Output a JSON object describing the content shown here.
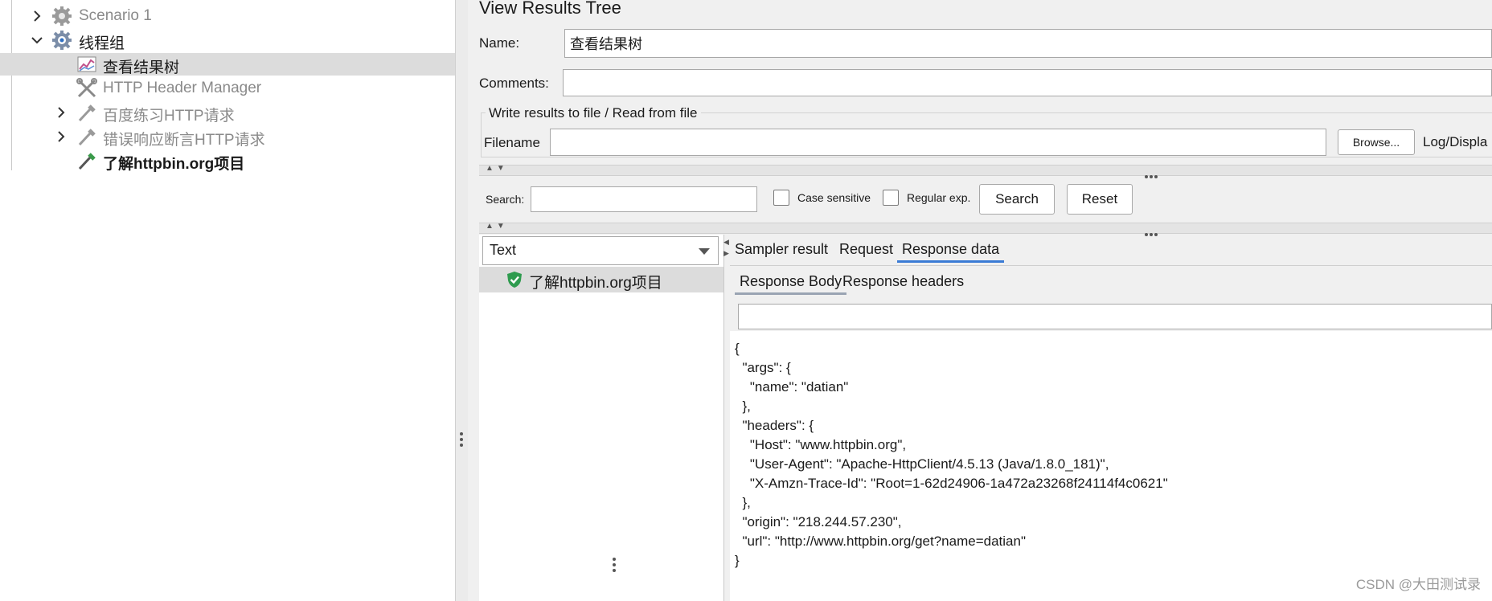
{
  "tree": {
    "items": [
      {
        "label": "Scenario 1",
        "icon": "gear-icon",
        "expand": "collapsed",
        "muted": true
      },
      {
        "label": "线程组",
        "icon": "gear-icon",
        "expand": "expanded",
        "muted": false
      },
      {
        "label": "查看结果树",
        "icon": "chart-icon",
        "expand": "none",
        "muted": false,
        "selected": true
      },
      {
        "label": "HTTP Header Manager",
        "icon": "tools-icon",
        "expand": "none",
        "muted": true
      },
      {
        "label": "百度练习HTTP请求",
        "icon": "pipette-icon",
        "expand": "collapsed",
        "muted": true
      },
      {
        "label": "错误响应断言HTTP请求",
        "icon": "pipette-icon",
        "expand": "collapsed",
        "muted": true
      },
      {
        "label": "了解httpbin.org项目",
        "icon": "pipette-icon",
        "expand": "none",
        "muted": false
      }
    ]
  },
  "panel": {
    "title": "View Results Tree",
    "name_label": "Name:",
    "name_value": "查看结果树",
    "comments_label": "Comments:",
    "comments_value": "",
    "file_section_label": "Write results to file / Read from file",
    "filename_label": "Filename",
    "filename_value": "",
    "browse_label": "Browse...",
    "log_display_label": "Log/Displa"
  },
  "search": {
    "label": "Search:",
    "value": "",
    "case_sensitive_label": "Case sensitive",
    "regex_label": "Regular exp.",
    "search_button": "Search",
    "reset_button": "Reset"
  },
  "results": {
    "renderer": "Text",
    "items": [
      {
        "label": "了解httpbin.org项目",
        "status": "success"
      }
    ]
  },
  "detail": {
    "tabs": [
      "Sampler result",
      "Request",
      "Response data"
    ],
    "active_tab": "Response data",
    "subtabs": [
      "Response Body",
      "Response headers"
    ],
    "active_subtab": "Response Body",
    "find_value": "",
    "response_body": "{\n  \"args\": {\n    \"name\": \"datian\"\n  },\n  \"headers\": {\n    \"Host\": \"www.httpbin.org\",\n    \"User-Agent\": \"Apache-HttpClient/4.5.13 (Java/1.8.0_181)\",\n    \"X-Amzn-Trace-Id\": \"Root=1-62d24906-1a472a23268f24114f4c0621\"\n  },\n  \"origin\": \"218.244.57.230\",\n  \"url\": \"http://www.httpbin.org/get?name=datian\"\n}"
  },
  "watermark": "CSDN @大田测试录",
  "colors": {
    "accent": "#3a7bd5",
    "selection": "#dcdcdc",
    "panel_bg": "#f0f0f0",
    "success": "#2e9b4e"
  }
}
